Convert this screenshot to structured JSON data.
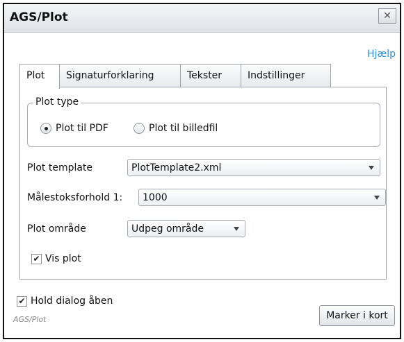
{
  "window": {
    "title": "AGS/Plot"
  },
  "help_link": "Hjælp",
  "tabs": [
    {
      "label": "Plot",
      "active": true
    },
    {
      "label": "Signaturforklaring",
      "active": false
    },
    {
      "label": "Tekster",
      "active": false
    },
    {
      "label": "Indstillinger",
      "active": false
    }
  ],
  "plot_type": {
    "legend": "Plot type",
    "options": [
      {
        "label": "Plot til PDF",
        "selected": true
      },
      {
        "label": "Plot til billedfil",
        "selected": false
      }
    ]
  },
  "form": {
    "template_label": "Plot template",
    "template_value": "PlotTemplate2.xml",
    "scale_label": "Målestoksforhold 1:",
    "scale_value": "1000",
    "area_label": "Plot område",
    "area_value": "Udpeg område",
    "show_plot_label": "Vis plot",
    "show_plot_checked": true
  },
  "footer": {
    "hold_dialog_label": "Hold dialog åben",
    "hold_dialog_checked": true,
    "app_name": "AGS/Plot",
    "mark_button": "Marker i kort"
  },
  "icons": {
    "close": "close-icon",
    "check": "checkmark-icon",
    "dropdown": "chevron-down-icon"
  }
}
